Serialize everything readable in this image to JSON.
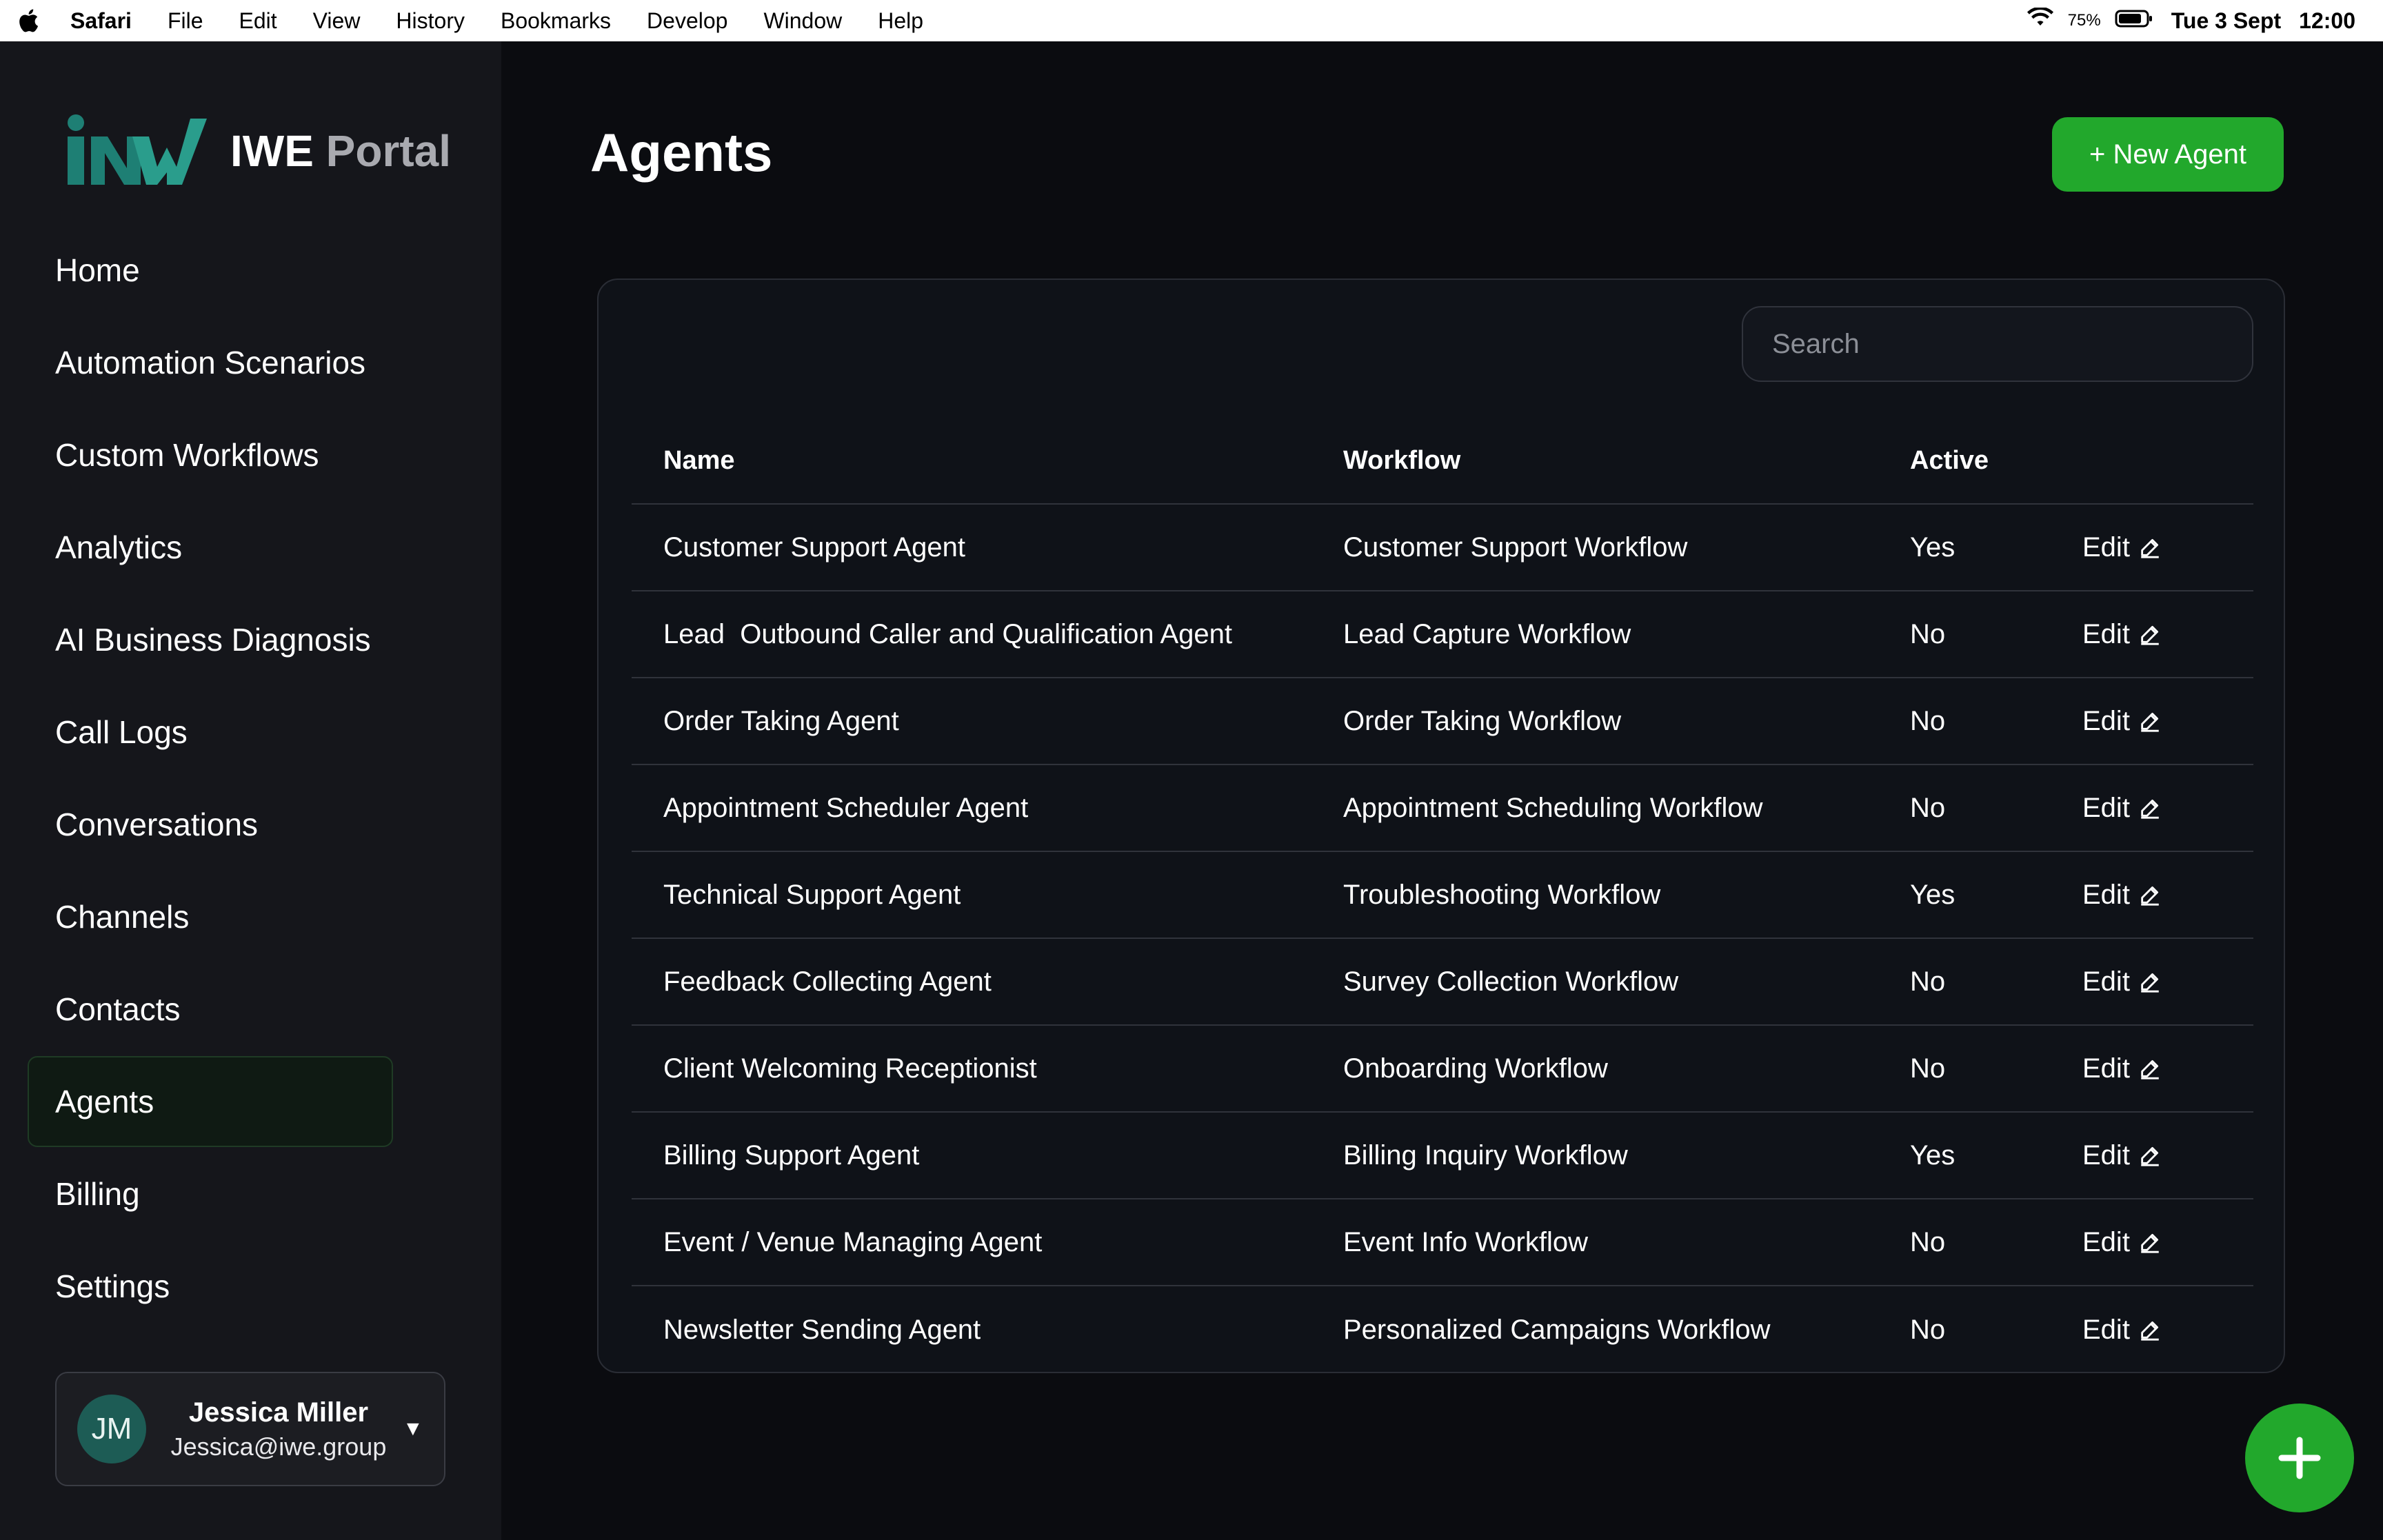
{
  "menubar": {
    "app": "Safari",
    "items": [
      "File",
      "Edit",
      "View",
      "History",
      "Bookmarks",
      "Develop",
      "Window",
      "Help"
    ],
    "battery": "75%",
    "date": "Tue 3 Sept",
    "time": "12:00"
  },
  "brand": {
    "name_primary": "IWE",
    "name_secondary": "Portal"
  },
  "nav": {
    "items": [
      {
        "label": "Home"
      },
      {
        "label": "Automation Scenarios"
      },
      {
        "label": "Custom Workflows"
      },
      {
        "label": "Analytics"
      },
      {
        "label": "AI Business Diagnosis"
      },
      {
        "label": "Call Logs"
      },
      {
        "label": "Conversations"
      },
      {
        "label": "Channels"
      },
      {
        "label": "Contacts"
      },
      {
        "label": "Agents"
      },
      {
        "label": "Billing"
      },
      {
        "label": "Settings"
      }
    ],
    "active": "Agents"
  },
  "user": {
    "initials": "JM",
    "name": "Jessica Miller",
    "email": "Jessica@iwe.group"
  },
  "page": {
    "title": "Agents",
    "new_button": "+ New Agent"
  },
  "search": {
    "placeholder": "Search",
    "value": ""
  },
  "table": {
    "headers": {
      "name": "Name",
      "workflow": "Workflow",
      "active": "Active"
    },
    "edit_label": "Edit",
    "rows": [
      {
        "name": "Customer Support Agent",
        "workflow": "Customer Support Workflow",
        "active": "Yes"
      },
      {
        "name": "Lead  Outbound Caller and Qualification Agent",
        "workflow": "Lead Capture Workflow",
        "active": "No"
      },
      {
        "name": "Order Taking Agent",
        "workflow": "Order Taking Workflow",
        "active": "No"
      },
      {
        "name": "Appointment Scheduler Agent",
        "workflow": "Appointment Scheduling Workflow",
        "active": "No"
      },
      {
        "name": "Technical Support Agent",
        "workflow": "Troubleshooting Workflow",
        "active": "Yes"
      },
      {
        "name": "Feedback Collecting Agent",
        "workflow": "Survey Collection Workflow",
        "active": "No"
      },
      {
        "name": "Client Welcoming Receptionist",
        "workflow": "Onboarding Workflow",
        "active": "No"
      },
      {
        "name": "Billing Support Agent",
        "workflow": "Billing Inquiry Workflow",
        "active": "Yes"
      },
      {
        "name": "Event / Venue Managing Agent",
        "workflow": "Event Info Workflow",
        "active": "No"
      },
      {
        "name": "Newsletter Sending Agent",
        "workflow": "Personalized Campaigns Workflow",
        "active": "No"
      }
    ]
  },
  "colors": {
    "accent": "#22a82c",
    "background": "#0b0c10",
    "sidebar": "#15161b",
    "logo_teal": "#1e7f74"
  },
  "icons": {
    "apple": "apple-logo-icon",
    "wifi": "wifi-icon",
    "battery": "battery-icon",
    "edit": "pencil-icon",
    "caret": "caret-down-icon",
    "fab": "plus-icon"
  }
}
